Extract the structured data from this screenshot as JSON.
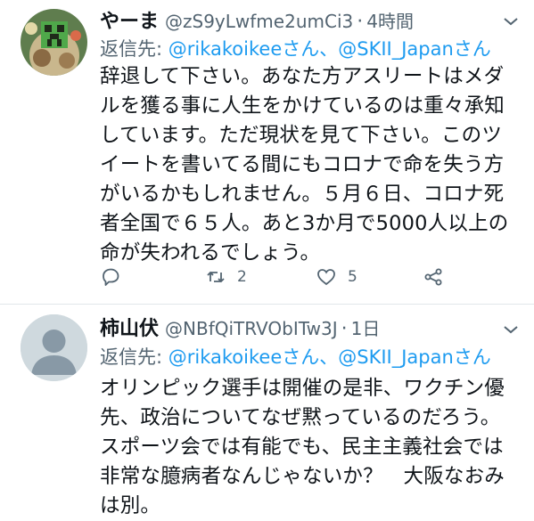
{
  "tweets": [
    {
      "name": "やーま",
      "handle": "@zS9yLwfme2umCi3",
      "time": "4時間",
      "reply_prefix": "返信先: ",
      "reply_mention_1": "@rikakoikeeさん",
      "reply_sep": "、",
      "reply_mention_2": "@SKII_Japanさん",
      "text": "辞退して下さい。あなた方アスリートはメダルを獲る事に人生をかけているのは重々承知しています。ただ現状を見て下さい。このツイートを書いてる間にもコロナで命を失う方がいるかもしれません。５月６日、コロナ死者全国で６５人。あと3か月で5000人以上の命が失われるでしょう。",
      "retweets": "2",
      "likes": "5"
    },
    {
      "name": "柿山伏",
      "handle": "@NBfQiTRVObITw3J",
      "time": "1日",
      "reply_prefix": "返信先: ",
      "reply_mention_1": "@rikakoikeeさん",
      "reply_sep": "、",
      "reply_mention_2": "@SKII_Japanさん",
      "text": "オリンピック選手は開催の是非、ワクチン優先、政治についてなぜ黙っているのだろう。スポーツ会では有能でも、民主主義社会では非常な臆病者なんじゃないか？　大阪なおみは別。"
    }
  ],
  "icons": {
    "reply": "reply-icon",
    "retweet": "retweet-icon",
    "like": "heart-icon",
    "share": "share-icon",
    "more": "chevron-down-icon"
  },
  "colors": {
    "link": "#1d9bf0",
    "secondary": "#536471",
    "divider": "#e1e6ea"
  }
}
